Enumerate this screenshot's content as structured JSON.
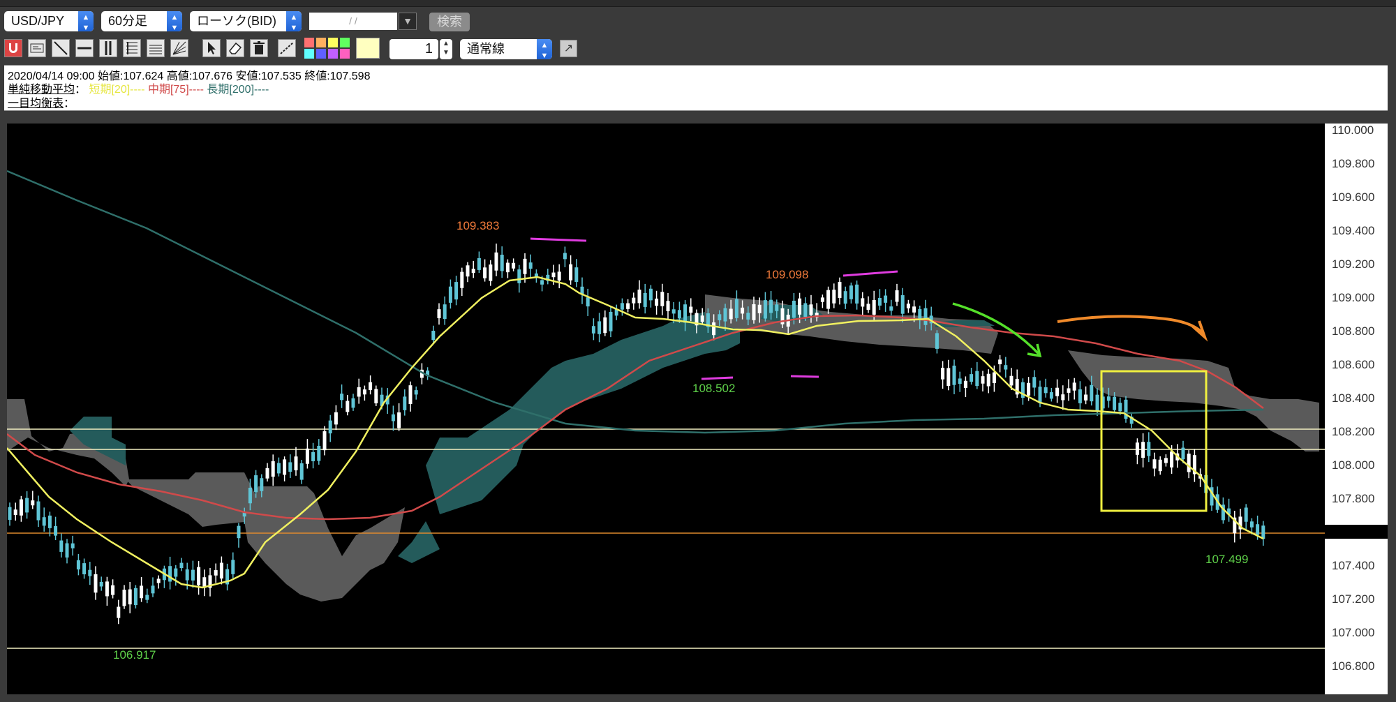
{
  "toolbar": {
    "symbol": "USD/JPY",
    "timeframe": "60分足",
    "chart_type": "ローソク(BID)",
    "date_placeholder": " / / ",
    "search_label": "検索",
    "line_width": "1",
    "line_style": "通常線",
    "palette_colors": [
      "#ff7070",
      "#ffb060",
      "#ffff60",
      "#60ff60",
      "#60ffff",
      "#6060ff",
      "#c060ff",
      "#ff60c0"
    ]
  },
  "info": {
    "ohlc": "2020/04/14 09:00 始値:107.624 高値:107.676 安値:107.535 終値:107.598",
    "sma_label": "単純移動平均",
    "sma_colon": "：",
    "sma_short": "短期[20]----",
    "sma_mid": "中期[75]----",
    "sma_long": "長期[200]----",
    "ichimoku_label": "一目均衡表",
    "ichimoku_colon": "："
  },
  "axis_ticks": [
    "110.000",
    "109.800",
    "109.600",
    "109.400",
    "109.200",
    "109.000",
    "108.800",
    "108.600",
    "108.400",
    "108.200",
    "108.000",
    "107.800",
    "107.400",
    "107.200",
    "107.000",
    "106.800"
  ],
  "annotations": {
    "high1": "109.383",
    "high2": "109.098",
    "low1": "108.502",
    "low2": "107.499",
    "low3": "106.917"
  },
  "colors": {
    "sma_short": "#f0f060",
    "sma_mid": "#d04a4a",
    "sma_long": "#2f6f6a",
    "cloud_bull": "#245b5b",
    "cloud_bear": "#5a5a5a",
    "candle": "#ffffff",
    "candle_down": "#5fc5d6"
  }
}
